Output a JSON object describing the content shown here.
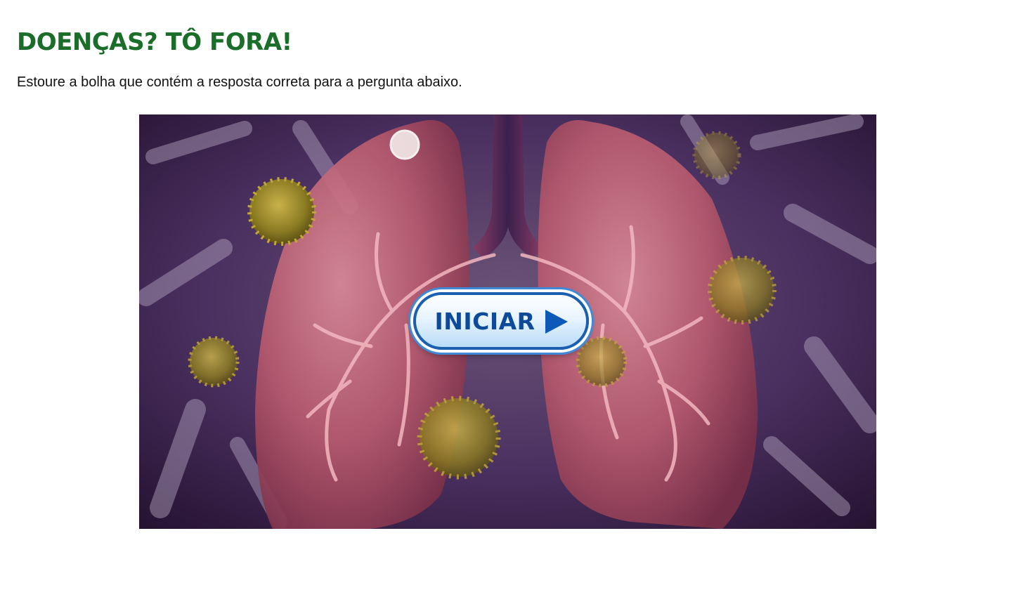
{
  "header": {
    "title": "DOENÇAS? TÔ FORA!",
    "instructions": "Estoure a bolha que contém a resposta correta para a pergunta abaixo."
  },
  "game": {
    "start_button_label": "INICIAR",
    "start_button_icon": "play-icon",
    "background_scene": "lungs-with-bacteria-illustration"
  },
  "colors": {
    "title": "#1b6e2a",
    "button_border": "#1a5fb0",
    "button_text": "#0d4b9a",
    "lung": "#b85a6e",
    "background": "#3b2352",
    "germ": "#8a7a22"
  }
}
